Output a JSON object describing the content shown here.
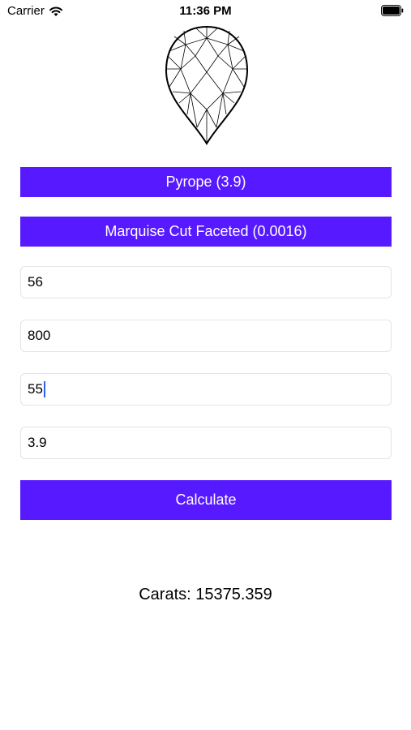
{
  "status_bar": {
    "carrier": "Carrier",
    "time": "11:36 PM",
    "wifi_icon": "wifi-icon",
    "battery_icon": "battery-icon"
  },
  "gem_image": {
    "icon": "pear-gem-icon"
  },
  "buttons": {
    "material_label": "Pyrope (3.9)",
    "cut_label": "Marquise Cut Faceted (0.0016)",
    "calculate_label": "Calculate"
  },
  "fields": [
    {
      "value": "56"
    },
    {
      "value": "800"
    },
    {
      "value": "55"
    },
    {
      "value": "3.9"
    }
  ],
  "result": {
    "text": "Carats: 15375.359"
  },
  "colors": {
    "accent": "#5719ff",
    "caret": "#2f5bff",
    "field_border": "#e4e4e4"
  }
}
